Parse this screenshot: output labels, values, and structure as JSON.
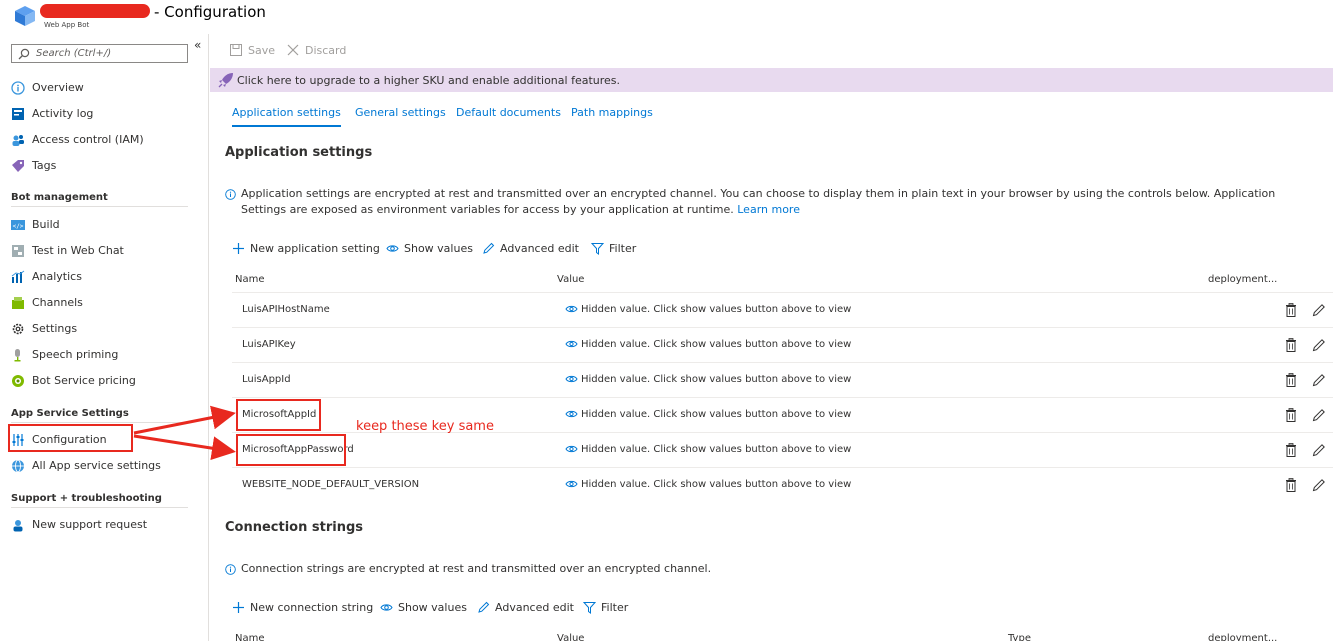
{
  "header": {
    "title": "- Configuration",
    "subtitle": "Web App Bot"
  },
  "sidebar": {
    "search_placeholder": "Search (Ctrl+/)",
    "collapse": "«",
    "items_top": [
      {
        "label": "Overview",
        "icon": "overview-icon"
      },
      {
        "label": "Activity log",
        "icon": "activity-log-icon"
      },
      {
        "label": "Access control (IAM)",
        "icon": "people-icon"
      },
      {
        "label": "Tags",
        "icon": "tag-icon"
      }
    ],
    "section_bot": "Bot management",
    "items_bot": [
      {
        "label": "Build",
        "icon": "code-icon"
      },
      {
        "label": "Test in Web Chat",
        "icon": "chat-icon"
      },
      {
        "label": "Analytics",
        "icon": "analytics-icon"
      },
      {
        "label": "Channels",
        "icon": "channels-icon"
      },
      {
        "label": "Settings",
        "icon": "gear-icon"
      },
      {
        "label": "Speech priming",
        "icon": "microphone-icon"
      },
      {
        "label": "Bot Service pricing",
        "icon": "pricing-icon"
      }
    ],
    "section_app": "App Service Settings",
    "items_app": [
      {
        "label": "Configuration",
        "icon": "sliders-icon"
      },
      {
        "label": "All App service settings",
        "icon": "globe-icon"
      }
    ],
    "section_support": "Support + troubleshooting",
    "items_support": [
      {
        "label": "New support request",
        "icon": "support-icon"
      }
    ]
  },
  "toolbar": {
    "save": "Save",
    "discard": "Discard"
  },
  "banner": {
    "text": "Click here to upgrade to a higher SKU and enable additional features."
  },
  "tabs": [
    "Application settings",
    "General settings",
    "Default documents",
    "Path mappings"
  ],
  "app_settings": {
    "heading": "Application settings",
    "info": "Application settings are encrypted at rest and transmitted over an encrypted channel. You can choose to display them in plain text in your browser by using the controls below. Application Settings are exposed as environment variables for access by your application at runtime.",
    "learn_more": "Learn more",
    "commands": {
      "new": "New application setting",
      "show": "Show values",
      "edit": "Advanced edit",
      "filter": "Filter"
    },
    "columns": {
      "name": "Name",
      "value": "Value",
      "deployment": "deployment..."
    },
    "rows": [
      {
        "name": "LuisAPIHostName",
        "value": "Hidden value. Click show values button above to view"
      },
      {
        "name": "LuisAPIKey",
        "value": "Hidden value. Click show values button above to view"
      },
      {
        "name": "LuisAppId",
        "value": "Hidden value. Click show values button above to view"
      },
      {
        "name": "MicrosoftAppId",
        "value": "Hidden value. Click show values button above to view"
      },
      {
        "name": "MicrosoftAppPassword",
        "value": "Hidden value. Click show values button above to view"
      },
      {
        "name": "WEBSITE_NODE_DEFAULT_VERSION",
        "value": "Hidden value. Click show values button above to view"
      }
    ]
  },
  "annotation": "keep these key same",
  "conn_strings": {
    "heading": "Connection strings",
    "info": "Connection strings are encrypted at rest and transmitted over an encrypted channel.",
    "commands": {
      "new": "New connection string",
      "show": "Show values",
      "edit": "Advanced edit",
      "filter": "Filter"
    },
    "columns": {
      "name": "Name",
      "value": "Value",
      "type": "Type",
      "deployment": "deployment..."
    }
  },
  "colors": {
    "accent": "#0078d4",
    "annotation_red": "#e8291f",
    "banner_bg": "#e8daef"
  }
}
